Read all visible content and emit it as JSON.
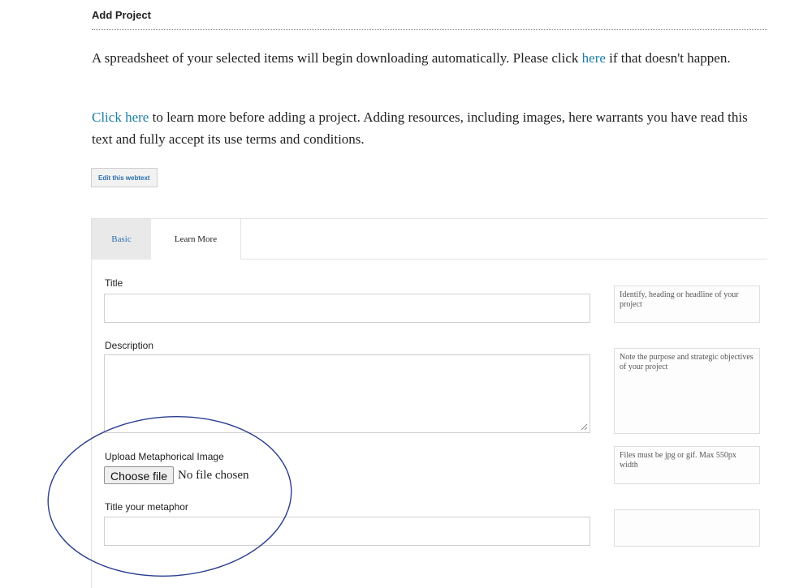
{
  "header": {
    "title": "Add Project"
  },
  "intro": {
    "download_text": "A spreadsheet of your selected items will begin downloading automatically. Please click ",
    "download_link": "here",
    "download_text_end": " if that doesn't happen.",
    "info_link": "Click here",
    "info_text": " to learn more before adding a project. Adding resources, including images, here warrants you have read this text and fully accept its use terms and conditions."
  },
  "edit_button_label": "Edit this webtext",
  "tabs": [
    {
      "label": "Basic",
      "active": true
    },
    {
      "label": "Learn More",
      "active": false
    }
  ],
  "form": {
    "title": {
      "label": "Title",
      "value": "",
      "help": "Identify, heading or headline of your project"
    },
    "description": {
      "label": "Description",
      "value": "",
      "help": "Note the purpose and strategic objectives of your project"
    },
    "upload": {
      "label": "Upload Metaphorical Image",
      "button_label": "Choose file",
      "status": "No file chosen",
      "help": "Files must be jpg or gif. Max 550px width"
    },
    "metaphor_title": {
      "label": "Title your metaphor",
      "value": "",
      "help": ""
    }
  },
  "colors": {
    "link": "#1b7fa6",
    "annotation": "#2b3d8f",
    "tab_active_bg": "#e9e9e9"
  }
}
